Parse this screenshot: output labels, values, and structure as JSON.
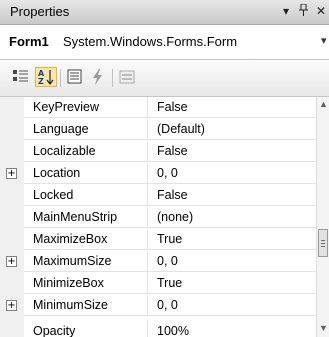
{
  "window": {
    "title": "Properties"
  },
  "object_selector": {
    "name": "Form1",
    "type": "System.Windows.Forms.Form"
  },
  "toolbar": {
    "buttons": [
      {
        "icon": "categorized-icon",
        "active": false
      },
      {
        "icon": "alphabetical-icon",
        "active": true
      },
      {
        "icon": "properties-icon",
        "active": false
      },
      {
        "icon": "events-icon",
        "active": false
      },
      {
        "icon": "property-pages-icon",
        "active": false
      }
    ]
  },
  "properties": [
    {
      "name": "KeyPreview",
      "value": "False",
      "expandable": false
    },
    {
      "name": "Language",
      "value": "(Default)",
      "expandable": false
    },
    {
      "name": "Localizable",
      "value": "False",
      "expandable": false
    },
    {
      "name": "Location",
      "value": "0, 0",
      "expandable": true
    },
    {
      "name": "Locked",
      "value": "False",
      "expandable": false
    },
    {
      "name": "MainMenuStrip",
      "value": "(none)",
      "expandable": false
    },
    {
      "name": "MaximizeBox",
      "value": "True",
      "expandable": false
    },
    {
      "name": "MaximumSize",
      "value": "0, 0",
      "expandable": true
    },
    {
      "name": "MinimizeBox",
      "value": "True",
      "expandable": false
    },
    {
      "name": "MinimumSize",
      "value": "0, 0",
      "expandable": true
    },
    {
      "name": "Opacity",
      "value": "100%",
      "expandable": false
    }
  ],
  "expander_glyph": "+",
  "colors": {
    "active_button": "#fbe8a8",
    "grid_line": "#e3e3e3",
    "margin": "#f0f0f0"
  }
}
